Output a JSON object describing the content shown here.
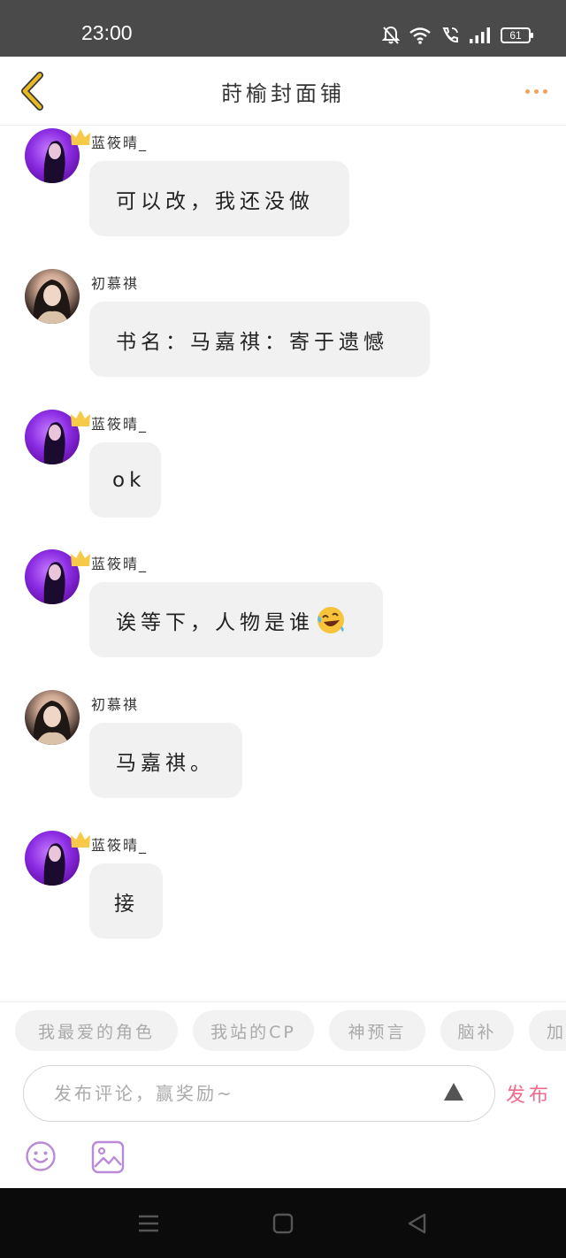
{
  "status_bar": {
    "time": "23:00",
    "battery": "61"
  },
  "header": {
    "title": "莳榆封面铺"
  },
  "messages": [
    {
      "user": "蓝筱晴_",
      "text": "可以改，我还没做"
    },
    {
      "user": "初慕祺",
      "text": "书名：马嘉祺：寄于遗憾"
    },
    {
      "user": "蓝筱晴_",
      "text": "ok"
    },
    {
      "user": "蓝筱晴_",
      "text": "诶等下，人物是谁"
    },
    {
      "user": "初慕祺",
      "text": "马嘉祺。"
    },
    {
      "user": "蓝筱晴_",
      "text": "接"
    }
  ],
  "topics": [
    "我最爱的角色",
    "我站的CP",
    "神预言",
    "脑补",
    "加"
  ],
  "comment": {
    "placeholder": "发布评论，赢奖励~",
    "publish_label": "发布"
  },
  "colors": {
    "accent": "#f06a8c",
    "more_dots": "#f2a25a",
    "tool_icon": "#b98ad6",
    "back_arrow": "#e8b923"
  }
}
